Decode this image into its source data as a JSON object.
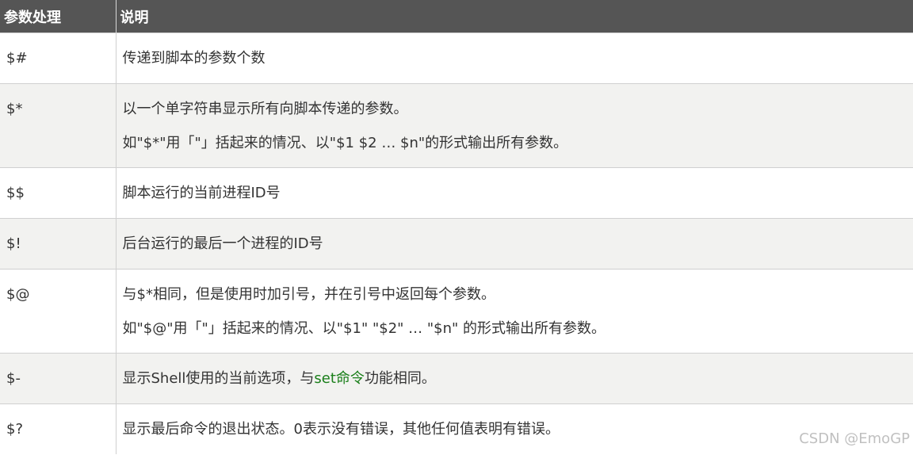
{
  "table": {
    "headers": [
      "参数处理",
      "说明"
    ],
    "rows": [
      {
        "param": "$#",
        "desc": [
          "传递到脚本的参数个数"
        ]
      },
      {
        "param": "$*",
        "desc": [
          "以一个单字符串显示所有向脚本传递的参数。",
          "如\"$*\"用「\"」括起来的情况、以\"$1 $2 … $n\"的形式输出所有参数。"
        ]
      },
      {
        "param": "$$",
        "desc": [
          "脚本运行的当前进程ID号"
        ]
      },
      {
        "param": "$!",
        "desc": [
          "后台运行的最后一个进程的ID号"
        ]
      },
      {
        "param": "$@",
        "desc": [
          "与$*相同，但是使用时加引号，并在引号中返回每个参数。",
          "如\"$@\"用「\"」括起来的情况、以\"$1\" \"$2\" … \"$n\" 的形式输出所有参数。"
        ]
      },
      {
        "param": "$-",
        "desc_parts": [
          "显示Shell使用的当前选项，与",
          "set命令",
          "功能相同。"
        ]
      },
      {
        "param": "$?",
        "desc": [
          "显示最后命令的退出状态。0表示没有错误，其他任何值表明有错误。"
        ]
      }
    ]
  },
  "watermark": "CSDN @EmoGP",
  "colors": {
    "header_bg": "#555555",
    "header_text": "#ffffff",
    "row_alt_bg": "#f2f2f0",
    "link": "#1a7f1a"
  }
}
